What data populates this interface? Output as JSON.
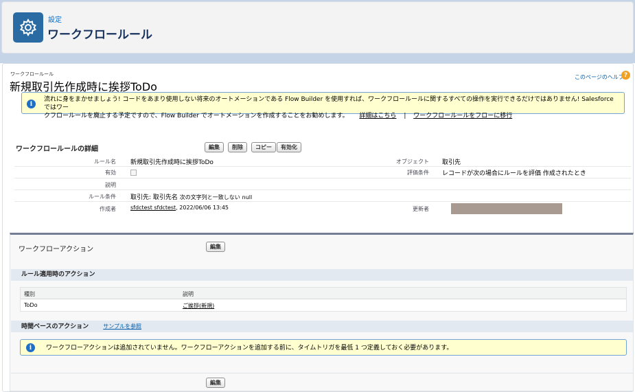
{
  "header": {
    "setup_label": "設定",
    "title": "ワークフロールール",
    "icon": "gear-icon"
  },
  "page": {
    "breadcrumb": "ワークフロールール",
    "title": "新規取引先作成時に挨拶ToDo",
    "help_link": "このページのヘルプ",
    "help_icon": "?"
  },
  "notice": {
    "icon": "info-icon",
    "line1": "流れに身をまかせましょう! コードをあまり使用しない将来のオートメーションである Flow Builder を使用すれば、ワークフロールールに関するすべての操作を実行できるだけではありません! Salesforce ではワー",
    "line2": "クフロールールを廃止する予定ですので、Flow Builder でオートメーションを作成することをお勧めします。",
    "link_details": "詳細はこちら",
    "separator": "|",
    "link_migrate": "ワークフロールールをフローに移行"
  },
  "detail": {
    "section_title": "ワークフロールールの詳細",
    "buttons": {
      "edit": "編集",
      "delete": "削除",
      "copy": "コピー",
      "activate": "有効化"
    },
    "rows": {
      "rule_name_label": "ルール名",
      "rule_name_value": "新規取引先作成時に挨拶ToDo",
      "object_label": "オブジェクト",
      "object_value": "取引先",
      "active_label": "有効",
      "active_checked": false,
      "eval_label": "評価条件",
      "eval_value": "レコードが次の場合にルールを評価 作成されたとき",
      "desc_label": "説明",
      "criteria_label": "ルール条件",
      "criteria_field": "取引先: 取引先名",
      "criteria_op": "次の文字列と一致しない",
      "criteria_value": "null",
      "created_label": "作成者",
      "created_user": "sfdctest sfdctest",
      "created_date": ", 2022/06/06 13:45",
      "modified_label": "更新者"
    }
  },
  "actions": {
    "section_title": "ワークフローアクション",
    "edit_button": "編集",
    "immediate_title": "ルール適用時のアクション",
    "table": {
      "headers": [
        "種別",
        "説明"
      ],
      "rows": [
        {
          "type": "ToDo",
          "description": "ご挨拶(新規)"
        }
      ]
    },
    "time_title": "時間ベースのアクション",
    "sample_link": "サンプルを参照",
    "time_notice": "ワークフローアクションは追加されていません。ワークフローアクションを追加する前に、タイムトリガを最低 1 つ定義しておく必要があります。",
    "bottom_edit_button": "編集"
  }
}
